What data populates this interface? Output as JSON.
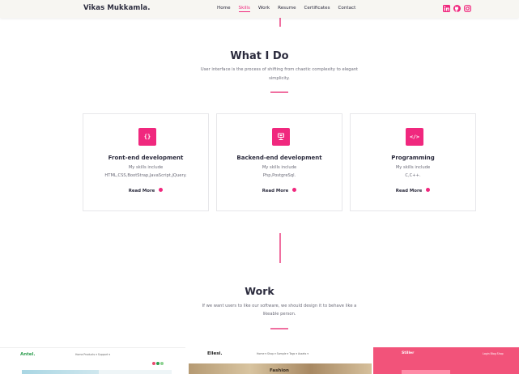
{
  "nav": {
    "brand": "Vikas Mukkamla.",
    "links": [
      "Home",
      "Skills",
      "Work",
      "Resume",
      "Certificates",
      "Contact"
    ],
    "active_link": "Skills",
    "social_icons": [
      "linkedin-icon",
      "github-icon",
      "instagram-icon"
    ]
  },
  "what_i_do": {
    "title": "What I Do",
    "subtitle_line1": "User interface is the process of shifting from chaotic complexity to elegant",
    "subtitle_line2": "simplicity."
  },
  "cards": [
    {
      "icon": "code-braces-icon",
      "icon_glyph": "{}",
      "title": "Front-end development",
      "line1": "My skills include",
      "line2": "HTML,CSS,BootStrap,JavaScript,jQuery.",
      "link": "Read More"
    },
    {
      "icon": "server-icon",
      "icon_glyph": "",
      "title": "Backend-end development",
      "line1": "My skills include",
      "line2": "Php,PostgreSql.",
      "link": "Read More"
    },
    {
      "icon": "code-tag-icon",
      "icon_glyph": "</>",
      "title": "Programming",
      "line1": "My skills include",
      "line2": "C,C++.",
      "link": "Read More"
    }
  ],
  "work": {
    "title": "Work",
    "subtitle_line1": "If we want users to like our software, we should design it to behave like a",
    "subtitle_line2": "likeable person."
  },
  "thumbnails": [
    {
      "brand": "Antel.",
      "menu": "Home   Products ▾   Support ▾"
    },
    {
      "brand": "Ellesi.",
      "menu": "Home ▾   Shop ▾   Sample ▾   Tags ▾   Assets ▾",
      "caption": "Fashion"
    },
    {
      "brand": "Stiller",
      "menu": "Login   Blog   Shop"
    }
  ],
  "colors": {
    "accent": "#f0287e",
    "navbar_bg": "#f7f6f2",
    "text": "#2b2b3d"
  }
}
